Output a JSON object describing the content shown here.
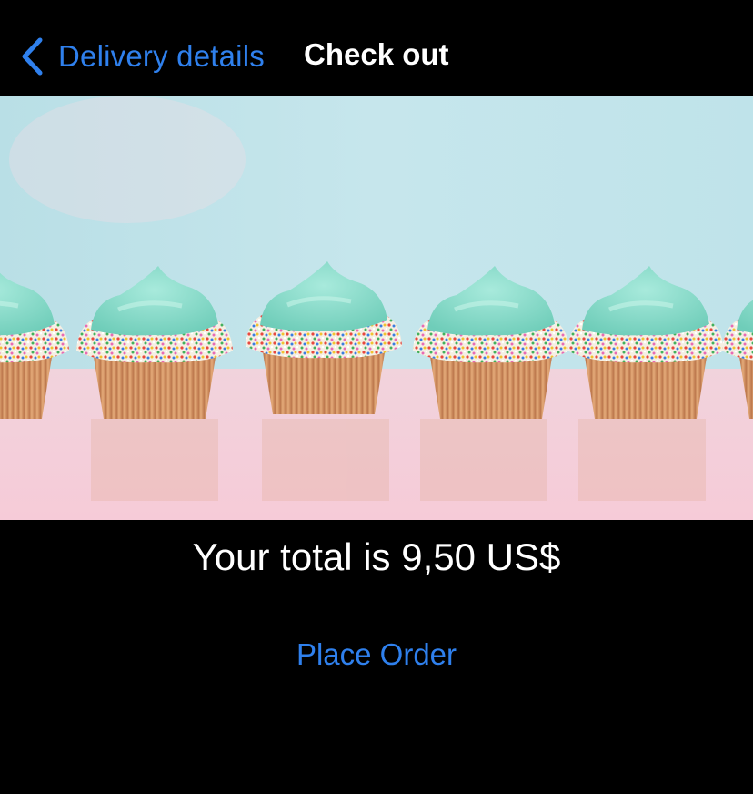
{
  "nav": {
    "back_label": "Delivery details",
    "back_icon": "chevron-left-icon",
    "title": "Check out"
  },
  "hero": {
    "subject": "cupcakes-photo"
  },
  "checkout": {
    "total_text": "Your total is 9,50 US$",
    "place_order_label": "Place Order"
  },
  "colors": {
    "background": "#000000",
    "accent": "#2f80ed",
    "text": "#ffffff"
  }
}
